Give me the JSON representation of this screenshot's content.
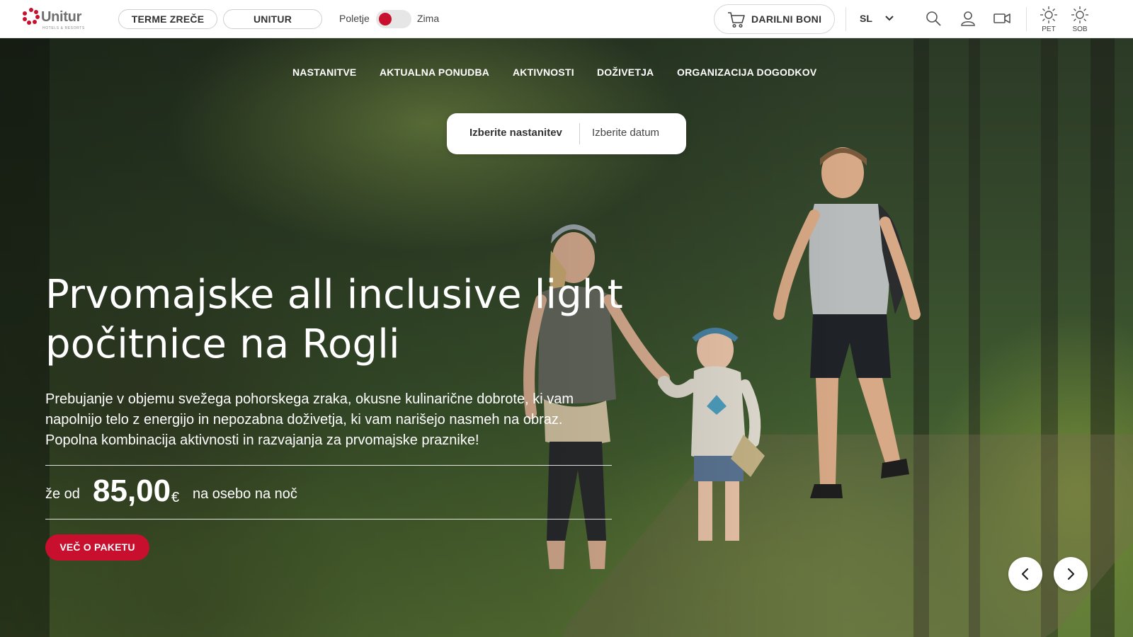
{
  "brand": {
    "name": "Unitur",
    "tagline": "HOTELS & RESORTS",
    "accent_color": "#c8102e"
  },
  "header": {
    "pills": [
      "TERME ZREČE",
      "UNITUR"
    ],
    "season": {
      "left_label": "Poletje",
      "right_label": "Zima",
      "selected": "Poletje"
    },
    "gift_vouchers": "DARILNI BONI",
    "language": "SL",
    "icons": [
      "search-icon",
      "user-icon",
      "video-camera-icon"
    ],
    "weather": [
      {
        "day": "PET",
        "icon": "sun-icon"
      },
      {
        "day": "SOB",
        "icon": "sun-icon"
      }
    ]
  },
  "nav": {
    "items": [
      "NASTANITVE",
      "AKTUALNA PONUDBA",
      "AKTIVNOSTI",
      "DOŽIVETJA",
      "ORGANIZACIJA DOGODKOV"
    ]
  },
  "booking": {
    "accommodation": "Izberite nastanitev",
    "date": "Izberite datum"
  },
  "hero": {
    "title": "Prvomajske all inclusive light počitnice na Rogli",
    "description": "Prebujanje v objemu svežega pohorskega zraka, okusne kulinarične dobrote, ki vam napolnijo telo z energijo in nepozabna doživetja, ki vam narišejo nasmeh na obraz. Popolna kombinacija aktivnosti in razvajanja za prvomajske praznike!",
    "price_prefix": "že od",
    "price": "85,00",
    "currency": "€",
    "price_suffix": "na osebo na noč",
    "cta": "VEČ O PAKETU"
  },
  "carousel": {
    "prev_icon": "chevron-left-icon",
    "next_icon": "chevron-right-icon"
  }
}
